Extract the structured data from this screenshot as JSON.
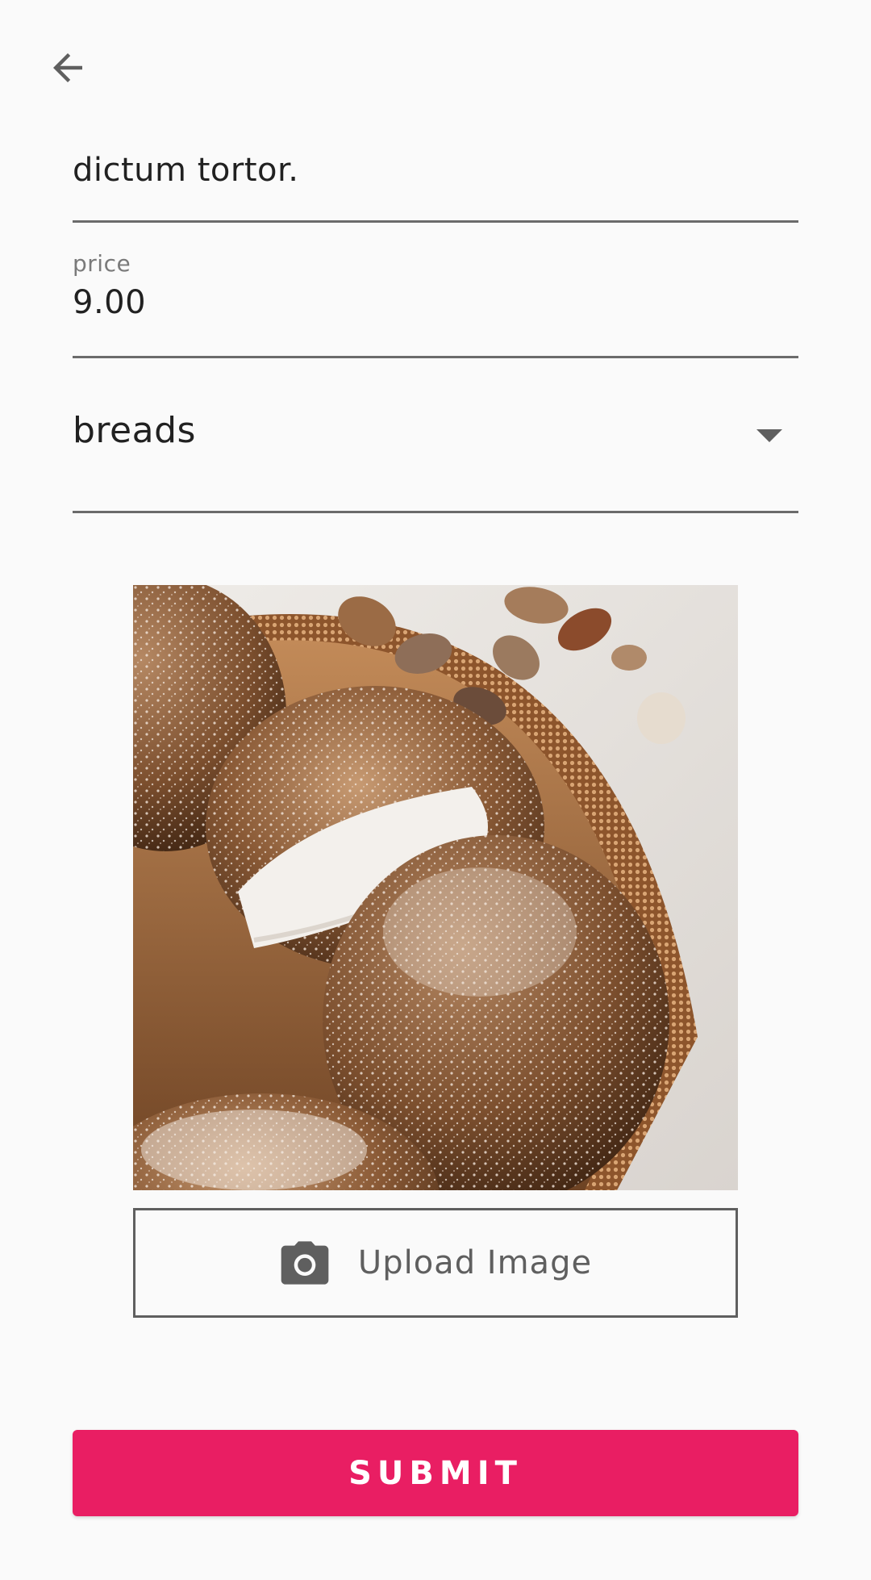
{
  "header": {
    "back_icon": "arrow-left-icon"
  },
  "form": {
    "title_value": "dictum tortor.",
    "price_label": "price",
    "price_value": "9.00",
    "category_value": "breads",
    "category_icon": "dropdown-caret-icon"
  },
  "image": {
    "description_icon": "cream-puff-photo"
  },
  "upload": {
    "icon": "camera-icon",
    "label": "Upload Image"
  },
  "submit": {
    "label": "SUBMIT"
  },
  "colors": {
    "accent": "#e91e63",
    "background": "#fafafa",
    "line": "#6b6b6b",
    "label": "#7a7a7a"
  }
}
